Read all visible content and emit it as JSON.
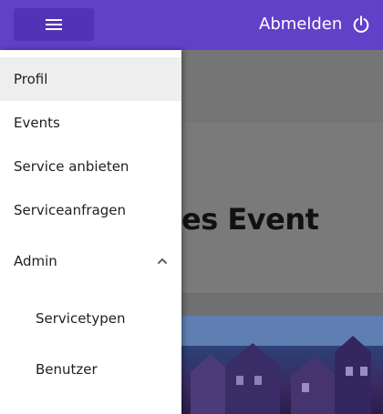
{
  "header": {
    "menu_icon": "hamburger-menu-icon",
    "logout_label": "Abmelden",
    "logout_icon": "power-icon"
  },
  "background": {
    "card_title_fragment": "es Event"
  },
  "drawer": {
    "items": [
      {
        "label": "Profil",
        "active": true
      },
      {
        "label": "Events",
        "active": false
      },
      {
        "label": "Service anbieten",
        "active": false
      },
      {
        "label": "Serviceanfragen",
        "active": false
      },
      {
        "label": "Admin",
        "active": false,
        "expanded": true,
        "chevron_icon": "chevron-up-icon"
      },
      {
        "label": "Servicetypen",
        "active": false,
        "sub": true
      },
      {
        "label": "Benutzer",
        "active": false,
        "sub": true
      }
    ]
  },
  "colors": {
    "primary": "#6240c8",
    "drawer_active": "#eeeeee"
  }
}
